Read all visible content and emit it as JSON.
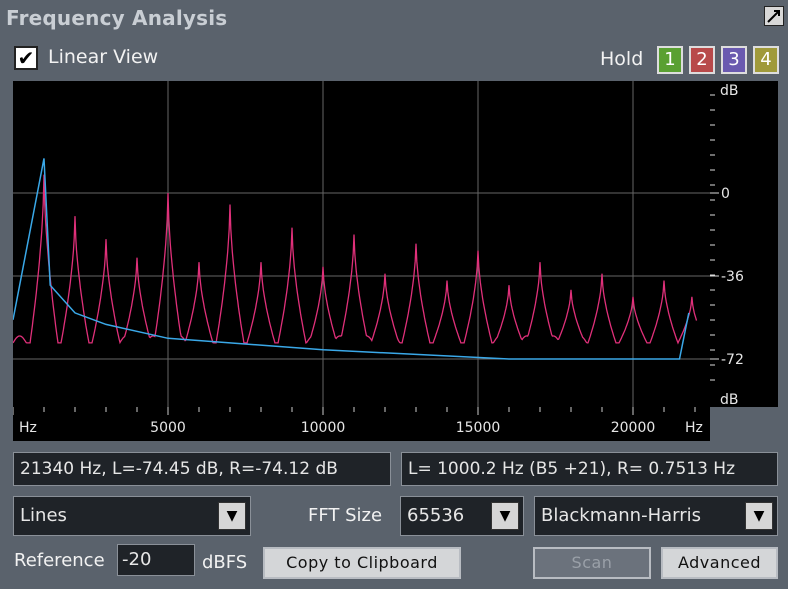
{
  "window": {
    "title": "Frequency Analysis"
  },
  "header": {
    "linear_view_label": "Linear View",
    "linear_view_checked": true,
    "hold_label": "Hold",
    "hold_buttons": [
      {
        "label": "1",
        "color": "#5aa032"
      },
      {
        "label": "2",
        "color": "#b84a4a"
      },
      {
        "label": "3",
        "color": "#6a5ab0"
      },
      {
        "label": "4",
        "color": "#a09a3a"
      }
    ]
  },
  "graph": {
    "db_top_label": "dB",
    "db_bottom_label": "dB",
    "y_ticks": [
      "0",
      "-36",
      "-72"
    ],
    "x_ticks": [
      "5000",
      "10000",
      "15000",
      "20000"
    ],
    "x_start_label": "Hz",
    "x_end_label": "Hz"
  },
  "chart_data": {
    "type": "line",
    "xlabel": "Hz",
    "ylabel": "dB",
    "xlim": [
      0,
      22050
    ],
    "ylim": [
      -86,
      45
    ],
    "x_tick_values": [
      5000,
      10000,
      15000,
      20000
    ],
    "y_tick_values": [
      0,
      -36,
      -72
    ],
    "grid": true,
    "colors": {
      "pink": "#e0307a",
      "blue": "#3aa8e8"
    },
    "series": [
      {
        "harmonic_peaks_hz": [
          1000,
          3000,
          5000,
          7000,
          9000,
          11000,
          13000,
          15000,
          17000,
          19000,
          21000
        ],
        "peaks": [
          [
            1000,
            8
          ],
          [
            2000,
            -10
          ],
          [
            3000,
            -20
          ],
          [
            4000,
            -28
          ],
          [
            5000,
            0
          ],
          [
            6000,
            -30
          ],
          [
            7000,
            -5
          ],
          [
            8000,
            -30
          ],
          [
            9000,
            -15
          ],
          [
            10000,
            -32
          ],
          [
            11000,
            -18
          ],
          [
            12000,
            -35
          ],
          [
            13000,
            -22
          ],
          [
            14000,
            -38
          ],
          [
            15000,
            -25
          ],
          [
            16000,
            -40
          ],
          [
            17000,
            -30
          ],
          [
            18000,
            -42
          ],
          [
            19000,
            -35
          ],
          [
            20000,
            -45
          ],
          [
            21000,
            -38
          ],
          [
            21900,
            -45
          ]
        ],
        "floor_db": -65
      },
      {
        "points": [
          [
            0,
            -55
          ],
          [
            1000,
            15
          ],
          [
            1200,
            -40
          ],
          [
            2000,
            -52
          ],
          [
            3000,
            -57
          ],
          [
            5000,
            -63
          ],
          [
            7000,
            -65
          ],
          [
            10000,
            -68
          ],
          [
            13000,
            -70
          ],
          [
            16000,
            -72
          ],
          [
            19000,
            -72
          ],
          [
            21500,
            -72
          ],
          [
            21800,
            -52
          ]
        ]
      }
    ]
  },
  "readouts": {
    "cursor": "21340 Hz, L=-74.45 dB, R=-74.12 dB",
    "peak": "L= 1000.2 Hz (B5 +21), R= 0.7513 Hz"
  },
  "controls": {
    "display_mode": "Lines",
    "fft_size_label": "FFT Size",
    "fft_size": "65536",
    "window_function": "Blackmann-Harris",
    "reference_label": "Reference",
    "reference_value": "-20",
    "reference_unit": "dBFS",
    "copy_button": "Copy to Clipboard",
    "scan_button": "Scan",
    "advanced_button": "Advanced"
  }
}
